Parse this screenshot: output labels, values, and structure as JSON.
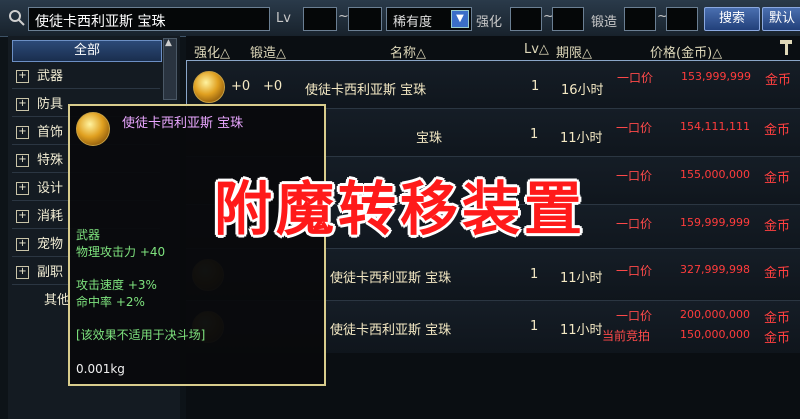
{
  "search": {
    "value": "使徒卡西利亚斯 宝珠",
    "lv_label": "Lv",
    "tilde1": "~",
    "rarity_value": "稀有度",
    "enhance_label": "强化",
    "tilde2": "~",
    "forge_label": "锻造",
    "tilde3": "~",
    "search_button": "搜索",
    "default_button": "默认"
  },
  "sidebar": {
    "all_label": "全部",
    "items": [
      {
        "label": "武器"
      },
      {
        "label": "防具"
      },
      {
        "label": "首饰"
      },
      {
        "label": "特殊"
      },
      {
        "label": "设计"
      },
      {
        "label": "消耗"
      },
      {
        "label": "宠物"
      },
      {
        "label": "副职"
      }
    ],
    "other_label": "其他"
  },
  "table": {
    "headers": {
      "enhance": "强化△",
      "forge": "锻造△",
      "name": "名称△",
      "lv": "Lv△",
      "period": "期限△",
      "price": "价格(金币)△"
    },
    "rows": [
      {
        "enhance": "+0",
        "forge": "+0",
        "name": "使徒卡西利亚斯 宝珠",
        "lv": "1",
        "period": "16小时",
        "price_type": "一口价",
        "price": "153,999,999",
        "coin": "金币"
      },
      {
        "name": "宝珠",
        "lv": "1",
        "period": "11小时",
        "price_type": "一口价",
        "price": "154,111,111",
        "coin": "金币"
      },
      {
        "price_type": "一口价",
        "price": "155,000,000",
        "coin": "金币"
      },
      {
        "price_type": "一口价",
        "price": "159,999,999",
        "coin": "金币"
      },
      {
        "name": "使徒卡西利亚斯 宝珠",
        "lv": "1",
        "period": "11小时",
        "price_type": "一口价",
        "price": "327,999,998",
        "coin": "金币"
      },
      {
        "name": "使徒卡西利亚斯 宝珠",
        "lv": "1",
        "period": "11小时",
        "price_type": "一口价",
        "price": "200,000,000",
        "coin": "金币",
        "bid_type": "当前竞拍",
        "bid_price": "150,000,000",
        "bid_coin": "金币"
      }
    ]
  },
  "tooltip": {
    "name": "使徒卡西利亚斯 宝珠",
    "category": "武器",
    "stat1": "物理攻击力 +40",
    "stat2": "攻击速度 +3%",
    "stat3": "命中率 +2%",
    "note": "[该效果不适用于决斗场]",
    "weight": "0.001kg"
  },
  "overlay_title": "附魔转移装置",
  "colors": {
    "overlay_red": "#ff1a1a",
    "price_red": "#ff3c3c",
    "tooltip_border": "#d8cc8c",
    "stat_green": "#7ee37e"
  }
}
